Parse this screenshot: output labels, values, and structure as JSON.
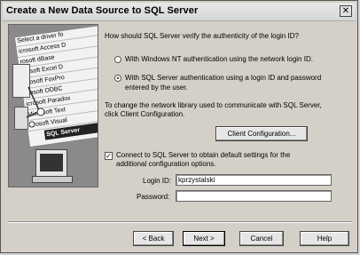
{
  "window": {
    "title": "Create a New Data Source to SQL Server",
    "close_glyph": "✕"
  },
  "illustration": {
    "sheet_lines": [
      "Select a driver fo",
      "icrosoft Access D",
      "rosoft dBase",
      "crosoft Excel D",
      "icrosoft FoxPro",
      "crosoft ODBC",
      "icrosoft Paradox",
      "Microsoft Text",
      "icrosoft Visual"
    ],
    "selected_line": "SQL Server"
  },
  "auth": {
    "question": "How should SQL Server verify the authenticity of the login ID?",
    "option_nt": "With Windows NT authentication using the network login ID.",
    "option_sql_line1": "With SQL Server authentication using a login ID and password",
    "option_sql_line2": "entered by the user.",
    "selected": "sql"
  },
  "network": {
    "text_line1": "To change the network library used to communicate with SQL Server,",
    "text_line2": "click Client Configuration.",
    "client_config_label": "Client Configuration..."
  },
  "connect": {
    "checked": true,
    "check_glyph": "✓",
    "label_line1": "Connect to SQL Server to obtain default settings for the",
    "label_line2": "additional configuration options.",
    "login_label": "Login ID:",
    "login_value": "kprzystalski",
    "password_label": "Password:",
    "password_value": ""
  },
  "buttons": {
    "back": "< Back",
    "next": "Next >",
    "cancel": "Cancel",
    "help": "Help"
  }
}
